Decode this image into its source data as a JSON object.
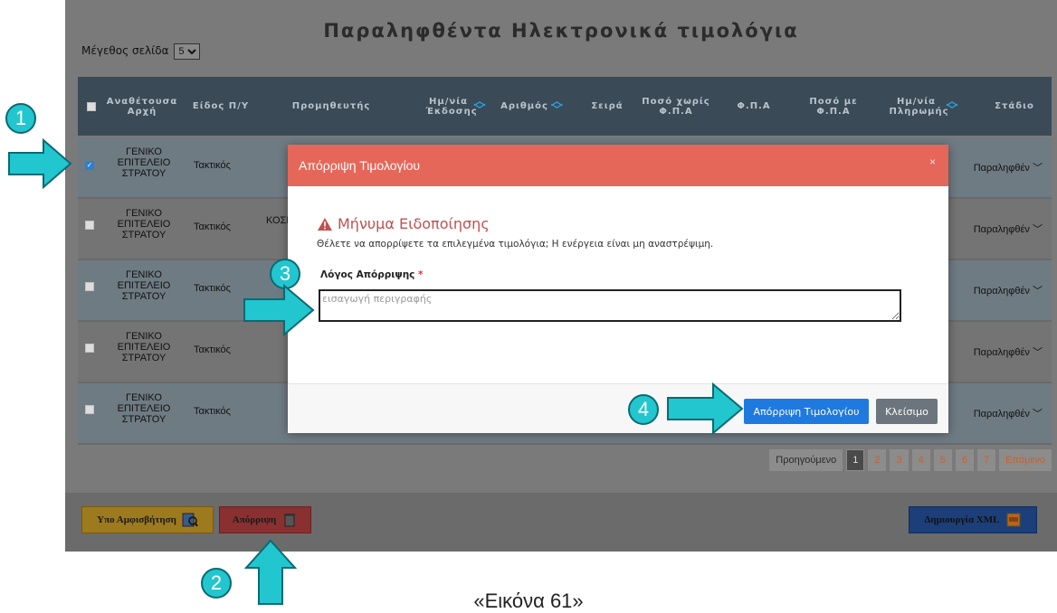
{
  "page": {
    "title": "Παραληφθέντα Ηλεκτρονικά τιμολόγια",
    "page_size_label": "Μέγεθος σελίδα",
    "page_size_value": "5"
  },
  "table": {
    "headers": [
      "Αναθέτουσα Αρχή",
      "Είδος Π/Υ",
      "Προμηθευτής",
      "Ημ/νία Έκδοσης",
      "Αριθμός",
      "Σειρά",
      "Ποσό χωρίς Φ.Π.Α",
      "Φ.Π.Α",
      "Ποσό με Φ.Π.Α",
      "Ημ/νία Πληρωμής",
      "Στάδιο"
    ],
    "rows": [
      {
        "org_line1": "ΓΕΝΙΚΟ",
        "org_line2": "ΕΠΙΤΕΛΕΙΟ",
        "org_line3": "ΣΤΡΑΤΟΥ",
        "type": "Τακτικός",
        "supplier": "",
        "stage": "Παραληφθέν",
        "checked": true
      },
      {
        "org_line1": "ΓΕΝΙΚΟ",
        "org_line2": "ΕΠΙΤΕΛΕΙΟ",
        "org_line3": "ΣΤΡΑΤΟΥ",
        "type": "Τακτικός",
        "supplier": "ΚΟΣΜ",
        "stage": "Παραληφθέν",
        "checked": false
      },
      {
        "org_line1": "ΓΕΝΙΚΟ",
        "org_line2": "ΕΠΙΤΕΛΕΙΟ",
        "org_line3": "ΣΤΡΑΤΟΥ",
        "type": "Τακτικός",
        "supplier": "",
        "stage": "Παραληφθέν",
        "checked": false
      },
      {
        "org_line1": "ΓΕΝΙΚΟ",
        "org_line2": "ΕΠΙΤΕΛΕΙΟ",
        "org_line3": "ΣΤΡΑΤΟΥ",
        "type": "Τακτικός",
        "supplier": "",
        "stage": "Παραληφθέν",
        "checked": false
      },
      {
        "org_line1": "ΓΕΝΙΚΟ",
        "org_line2": "ΕΠΙΤΕΛΕΙΟ",
        "org_line3": "ΣΤΡΑΤΟΥ",
        "type": "Τακτικός",
        "supplier": "",
        "stage": "Παραληφθέν",
        "checked": false
      }
    ]
  },
  "pagination": {
    "prev": "Προηγούμενο",
    "pages": [
      "1",
      "2",
      "3",
      "4",
      "5",
      "6",
      "7"
    ],
    "next": "Επόμενο",
    "active": "1"
  },
  "footer": {
    "dispute_label": "Υπο Αμφισβήτηση",
    "reject_label": "Απόρριψη",
    "xml_label": "Δημιουργία XML"
  },
  "modal": {
    "title": "Απόρριψη Τιμολογίου",
    "close_glyph": "×",
    "warning_title": "Μήνυμα Ειδοποίησης",
    "warning_text": "Θέλετε να απορρίψετε τα επιλεγμένα τιμολόγια; Η ενέργεια είναι μη αναστρέψιμη.",
    "reason_label": "Λόγος Απόρριψης",
    "reason_required": "*",
    "reason_placeholder": "εισαγωγή περιγραφής",
    "confirm_label": "Απόρριψη Τιμολογίου",
    "close_label": "Κλείσιμο"
  },
  "callouts": {
    "c1": "1",
    "c2": "2",
    "c3": "3",
    "c4": "4"
  },
  "caption": "«Εικόνα 61»",
  "colors": {
    "modal_header": "#e5675a",
    "callout": "#22c6cf",
    "confirm": "#1f7ae0",
    "table_header": "#3a4a56"
  }
}
